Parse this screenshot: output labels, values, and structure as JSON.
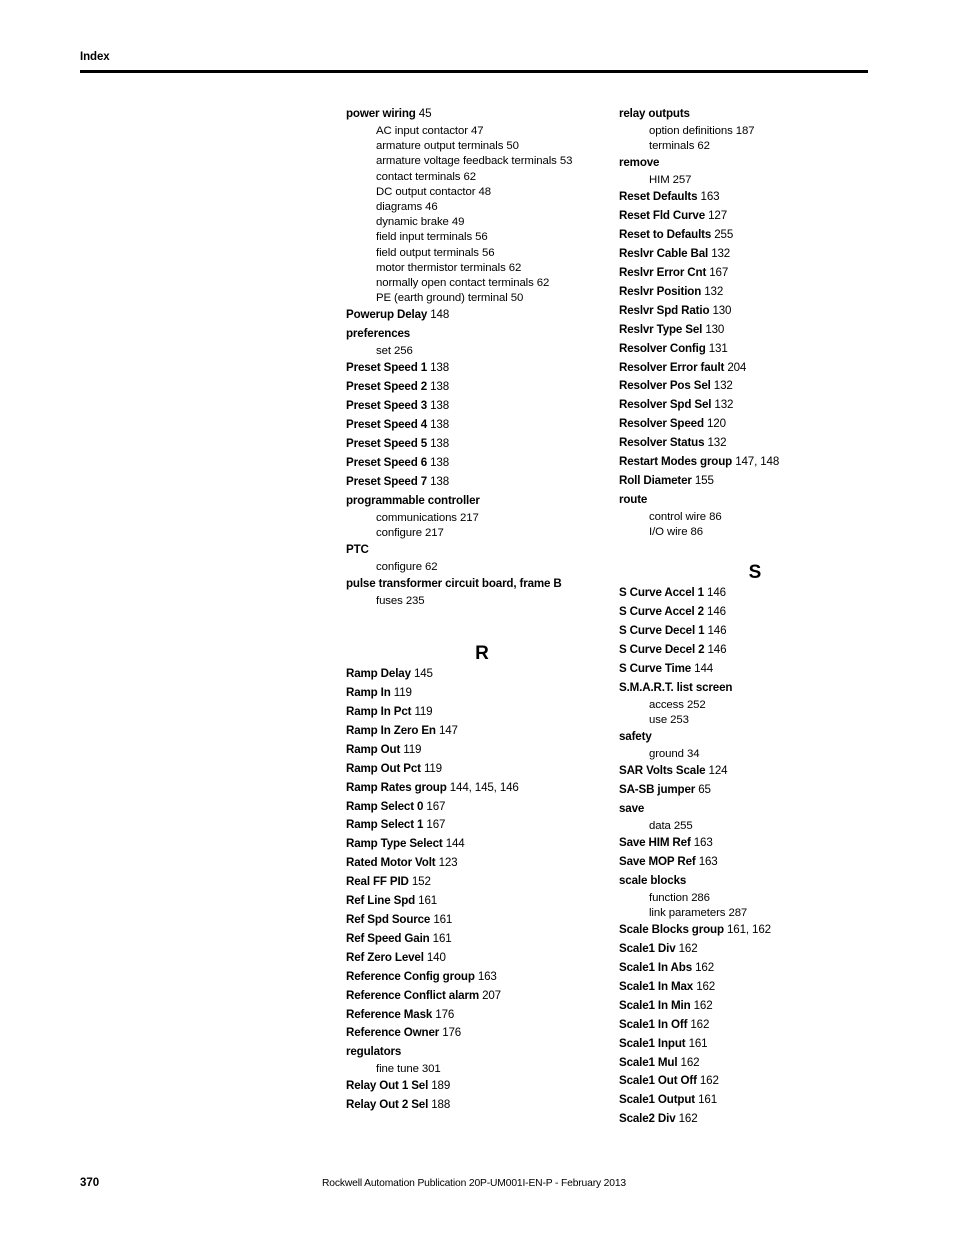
{
  "header": {
    "label": "Index"
  },
  "footer": {
    "page_number": "370",
    "publication": "Rockwell Automation Publication 20P-UM001I-EN-P - February 2013"
  },
  "columns": {
    "left": [
      {
        "type": "main",
        "term": "power wiring",
        "pages": "45"
      },
      {
        "type": "sub",
        "term": "AC input contactor",
        "pages": "47"
      },
      {
        "type": "sub",
        "term": "armature output terminals",
        "pages": "50"
      },
      {
        "type": "sub",
        "term": "armature voltage feedback terminals",
        "pages": "53"
      },
      {
        "type": "sub",
        "term": "contact terminals",
        "pages": "62"
      },
      {
        "type": "sub",
        "term": "DC output contactor",
        "pages": "48"
      },
      {
        "type": "sub",
        "term": "diagrams",
        "pages": "46"
      },
      {
        "type": "sub",
        "term": "dynamic brake",
        "pages": "49"
      },
      {
        "type": "sub",
        "term": "field input terminals",
        "pages": "56"
      },
      {
        "type": "sub",
        "term": "field output terminals",
        "pages": "56"
      },
      {
        "type": "sub",
        "term": "motor thermistor terminals",
        "pages": "62"
      },
      {
        "type": "sub",
        "term": "normally open contact terminals",
        "pages": "62"
      },
      {
        "type": "sub",
        "term": "PE (earth ground) terminal",
        "pages": "50"
      },
      {
        "type": "main",
        "term": "Powerup Delay",
        "pages": "148"
      },
      {
        "type": "main",
        "term": "preferences",
        "pages": ""
      },
      {
        "type": "sub",
        "term": "set",
        "pages": "256"
      },
      {
        "type": "main",
        "term": "Preset Speed 1",
        "pages": "138"
      },
      {
        "type": "main",
        "term": "Preset Speed 2",
        "pages": "138"
      },
      {
        "type": "main",
        "term": "Preset Speed 3",
        "pages": "138"
      },
      {
        "type": "main",
        "term": "Preset Speed 4",
        "pages": "138"
      },
      {
        "type": "main",
        "term": "Preset Speed 5",
        "pages": "138"
      },
      {
        "type": "main",
        "term": "Preset Speed 6",
        "pages": "138"
      },
      {
        "type": "main",
        "term": "Preset Speed 7",
        "pages": "138"
      },
      {
        "type": "main",
        "term": "programmable controller",
        "pages": ""
      },
      {
        "type": "sub",
        "term": "communications",
        "pages": "217"
      },
      {
        "type": "sub",
        "term": "configure",
        "pages": "217"
      },
      {
        "type": "main",
        "term": "PTC",
        "pages": ""
      },
      {
        "type": "sub",
        "term": "configure",
        "pages": "62"
      },
      {
        "type": "main",
        "term": "pulse transformer circuit board, frame B",
        "pages": ""
      },
      {
        "type": "sub",
        "term": "fuses",
        "pages": "235"
      },
      {
        "type": "spacer",
        "size": "lg"
      },
      {
        "type": "letter",
        "letter": "R"
      },
      {
        "type": "main",
        "term": "Ramp Delay",
        "pages": "145"
      },
      {
        "type": "main",
        "term": "Ramp In",
        "pages": "119"
      },
      {
        "type": "main",
        "term": "Ramp In Pct",
        "pages": "119"
      },
      {
        "type": "main",
        "term": "Ramp In Zero En",
        "pages": "147"
      },
      {
        "type": "main",
        "term": "Ramp Out",
        "pages": "119"
      },
      {
        "type": "main",
        "term": "Ramp Out Pct",
        "pages": "119"
      },
      {
        "type": "main",
        "term": "Ramp Rates group",
        "pages": "144, 145, 146"
      },
      {
        "type": "main",
        "term": "Ramp Select 0",
        "pages": "167"
      },
      {
        "type": "main",
        "term": "Ramp Select 1",
        "pages": "167"
      },
      {
        "type": "main",
        "term": "Ramp Type Select",
        "pages": "144"
      },
      {
        "type": "main",
        "term": "Rated Motor Volt",
        "pages": "123"
      },
      {
        "type": "main",
        "term": "Real FF PID",
        "pages": "152"
      },
      {
        "type": "main",
        "term": "Ref Line Spd",
        "pages": "161"
      },
      {
        "type": "main",
        "term": "Ref Spd Source",
        "pages": "161"
      },
      {
        "type": "main",
        "term": "Ref Speed Gain",
        "pages": "161"
      },
      {
        "type": "main",
        "term": "Ref Zero Level",
        "pages": "140"
      },
      {
        "type": "main",
        "term": "Reference Config group",
        "pages": "163"
      },
      {
        "type": "main",
        "term": "Reference Conflict alarm",
        "pages": "207"
      },
      {
        "type": "main",
        "term": "Reference Mask",
        "pages": "176"
      },
      {
        "type": "main",
        "term": "Reference Owner",
        "pages": "176"
      },
      {
        "type": "main",
        "term": "regulators",
        "pages": ""
      },
      {
        "type": "sub",
        "term": "fine tune",
        "pages": "301"
      },
      {
        "type": "main",
        "term": "Relay Out 1 Sel",
        "pages": "189"
      },
      {
        "type": "main",
        "term": "Relay Out 2 Sel",
        "pages": "188"
      }
    ],
    "right": [
      {
        "type": "main",
        "term": "relay outputs",
        "pages": ""
      },
      {
        "type": "sub",
        "term": "option definitions",
        "pages": "187"
      },
      {
        "type": "sub",
        "term": "terminals",
        "pages": "62"
      },
      {
        "type": "main",
        "term": "remove",
        "pages": ""
      },
      {
        "type": "sub",
        "term": "HIM",
        "pages": "257"
      },
      {
        "type": "main",
        "term": "Reset Defaults",
        "pages": "163"
      },
      {
        "type": "main",
        "term": "Reset Fld Curve",
        "pages": "127"
      },
      {
        "type": "main",
        "term": "Reset to Defaults",
        "pages": "255"
      },
      {
        "type": "main",
        "term": "Reslvr Cable Bal",
        "pages": "132"
      },
      {
        "type": "main",
        "term": "Reslvr Error Cnt",
        "pages": "167"
      },
      {
        "type": "main",
        "term": "Reslvr Position",
        "pages": "132"
      },
      {
        "type": "main",
        "term": "Reslvr Spd Ratio",
        "pages": "130"
      },
      {
        "type": "main",
        "term": "Reslvr Type Sel",
        "pages": "130"
      },
      {
        "type": "main",
        "term": "Resolver Config",
        "pages": "131"
      },
      {
        "type": "main",
        "term": "Resolver Error fault",
        "pages": "204"
      },
      {
        "type": "main",
        "term": "Resolver Pos Sel",
        "pages": "132"
      },
      {
        "type": "main",
        "term": "Resolver Spd Sel",
        "pages": "132"
      },
      {
        "type": "main",
        "term": "Resolver Speed",
        "pages": "120"
      },
      {
        "type": "main",
        "term": "Resolver Status",
        "pages": "132"
      },
      {
        "type": "main",
        "term": "Restart Modes group",
        "pages": "147, 148"
      },
      {
        "type": "main",
        "term": "Roll Diameter",
        "pages": "155"
      },
      {
        "type": "main",
        "term": "route",
        "pages": ""
      },
      {
        "type": "sub",
        "term": "control wire",
        "pages": "86"
      },
      {
        "type": "sub",
        "term": "I/O wire",
        "pages": "86"
      },
      {
        "type": "spacer",
        "size": "md"
      },
      {
        "type": "letter",
        "letter": "S"
      },
      {
        "type": "main",
        "term": "S Curve Accel 1",
        "pages": "146"
      },
      {
        "type": "main",
        "term": "S Curve Accel 2",
        "pages": "146"
      },
      {
        "type": "main",
        "term": "S Curve Decel 1",
        "pages": "146"
      },
      {
        "type": "main",
        "term": "S Curve Decel 2",
        "pages": "146"
      },
      {
        "type": "main",
        "term": "S Curve Time",
        "pages": "144"
      },
      {
        "type": "main",
        "term": "S.M.A.R.T. list screen",
        "pages": ""
      },
      {
        "type": "sub",
        "term": "access",
        "pages": "252"
      },
      {
        "type": "sub",
        "term": "use",
        "pages": "253"
      },
      {
        "type": "main",
        "term": "safety",
        "pages": ""
      },
      {
        "type": "sub",
        "term": "ground",
        "pages": "34"
      },
      {
        "type": "main",
        "term": "SAR Volts Scale",
        "pages": "124"
      },
      {
        "type": "main",
        "term": "SA-SB jumper",
        "pages": "65"
      },
      {
        "type": "main",
        "term": "save",
        "pages": ""
      },
      {
        "type": "sub",
        "term": "data",
        "pages": "255"
      },
      {
        "type": "main",
        "term": "Save HIM Ref",
        "pages": "163"
      },
      {
        "type": "main",
        "term": "Save MOP Ref",
        "pages": "163"
      },
      {
        "type": "main",
        "term": "scale blocks",
        "pages": ""
      },
      {
        "type": "sub",
        "term": "function",
        "pages": "286"
      },
      {
        "type": "sub",
        "term": "link parameters",
        "pages": "287"
      },
      {
        "type": "main",
        "term": "Scale Blocks group",
        "pages": "161, 162"
      },
      {
        "type": "main",
        "term": "Scale1 Div",
        "pages": "162"
      },
      {
        "type": "main",
        "term": "Scale1 In Abs",
        "pages": "162"
      },
      {
        "type": "main",
        "term": "Scale1 In Max",
        "pages": "162"
      },
      {
        "type": "main",
        "term": "Scale1 In Min",
        "pages": "162"
      },
      {
        "type": "main",
        "term": "Scale1 In Off",
        "pages": "162"
      },
      {
        "type": "main",
        "term": "Scale1 Input",
        "pages": "161"
      },
      {
        "type": "main",
        "term": "Scale1 Mul",
        "pages": "162"
      },
      {
        "type": "main",
        "term": "Scale1 Out Off",
        "pages": "162"
      },
      {
        "type": "main",
        "term": "Scale1 Output",
        "pages": "161"
      },
      {
        "type": "main",
        "term": "Scale2 Div",
        "pages": "162"
      }
    ]
  }
}
